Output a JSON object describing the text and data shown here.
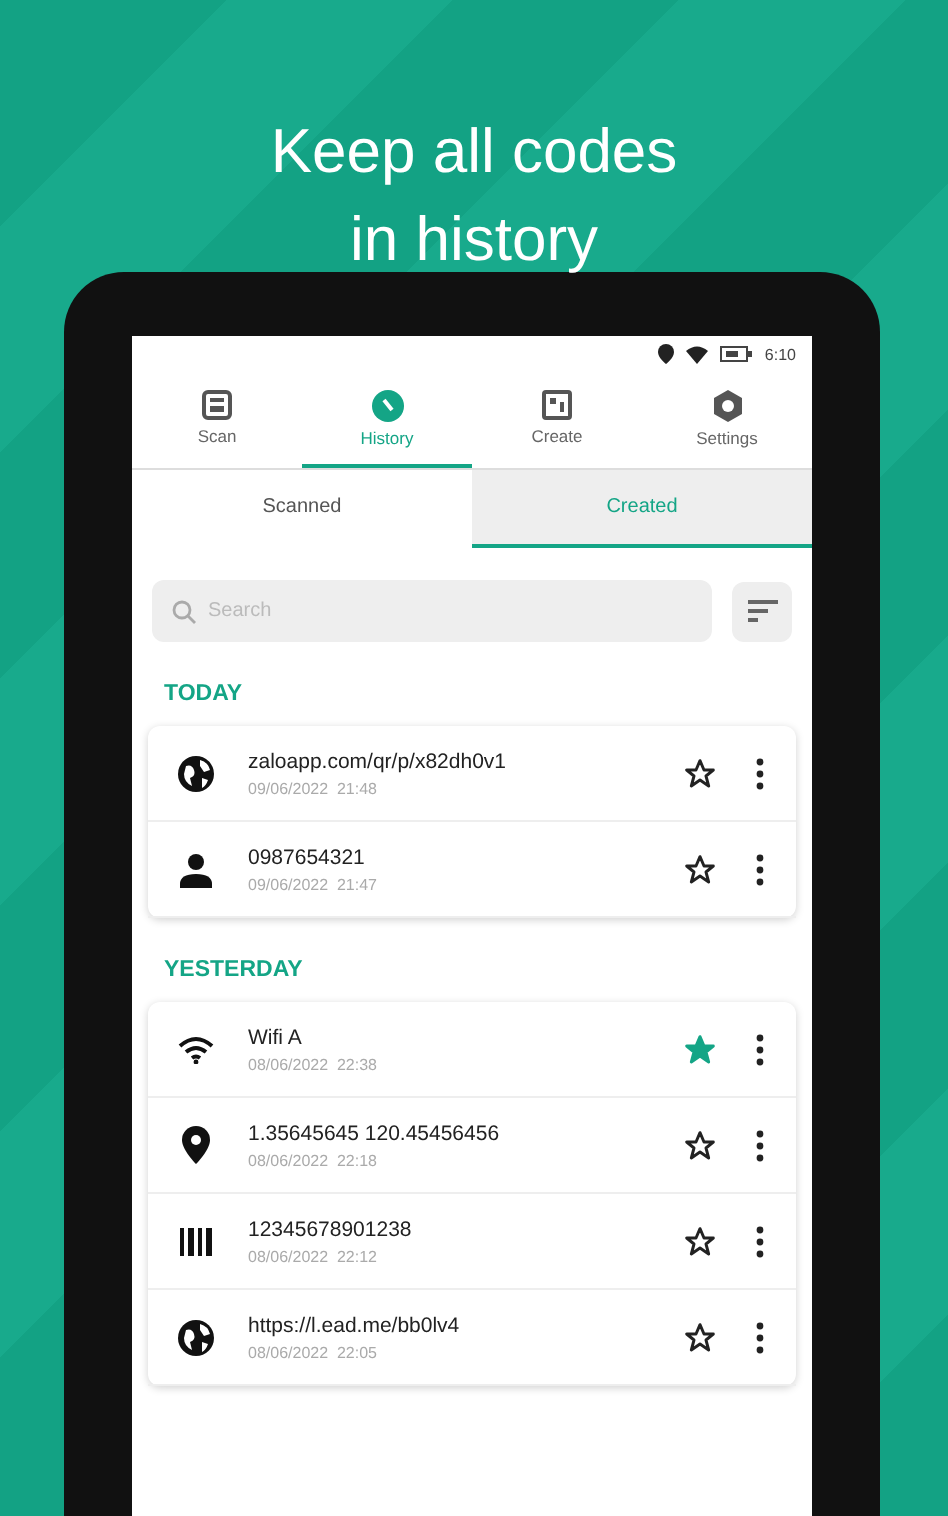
{
  "headline": "Keep all codes\nin history",
  "status_bar": {
    "time": "6:10"
  },
  "nav_tabs": [
    {
      "label": "Scan",
      "kind": "scan",
      "selected": false
    },
    {
      "label": "History",
      "kind": "history",
      "selected": true
    },
    {
      "label": "Create",
      "kind": "create",
      "selected": false
    },
    {
      "label": "Settings",
      "kind": "settings",
      "selected": false
    }
  ],
  "sub_tabs": [
    {
      "label": "Scanned",
      "selected": false
    },
    {
      "label": "Created",
      "selected": true
    }
  ],
  "search": {
    "placeholder": "Search"
  },
  "groups": [
    {
      "title": "TODAY",
      "items": [
        {
          "kind": "url",
          "text": "zaloapp.com/qr/p/x82dh0v1",
          "date": "09/06/2022  21:48",
          "starred": false
        },
        {
          "kind": "contact",
          "text": "0987654321",
          "date": "09/06/2022  21:47",
          "starred": false
        }
      ]
    },
    {
      "title": "YESTERDAY",
      "items": [
        {
          "kind": "wifi",
          "text": "Wifi A",
          "date": "08/06/2022  22:38",
          "starred": true
        },
        {
          "kind": "location",
          "text": "1.35645645 120.45456456",
          "date": "08/06/2022  22:18",
          "starred": false
        },
        {
          "kind": "barcode",
          "text": "12345678901238",
          "date": "08/06/2022  22:12",
          "starred": false
        },
        {
          "kind": "url",
          "text": "https://l.ead.me/bb0lv4",
          "date": "08/06/2022  22:05",
          "starred": false
        }
      ]
    }
  ]
}
